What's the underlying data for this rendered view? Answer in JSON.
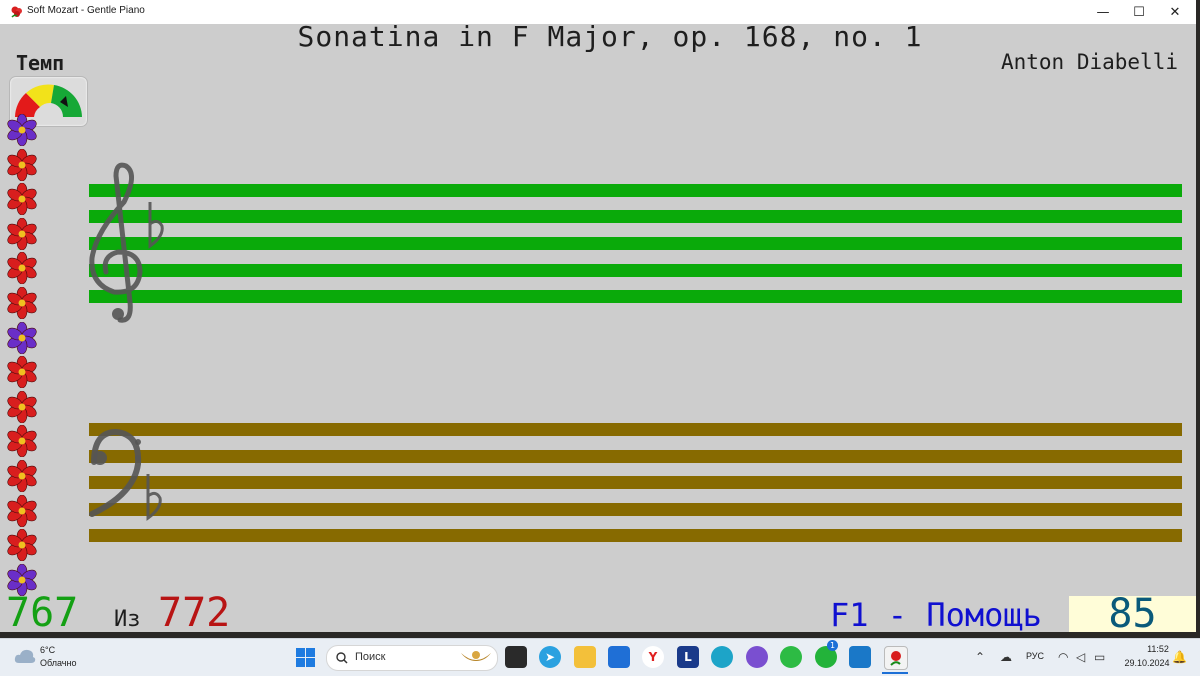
{
  "window": {
    "title": "Soft Mozart - Gentle Piano",
    "controls": {
      "minimize": "—",
      "maximize": "☐",
      "close": "✕"
    }
  },
  "score": {
    "title": "Sonatina in F Major, op. 168, no. 1",
    "composer": "Anton Diabelli",
    "tempo_label": "Темп",
    "treble_staff_color": "#0aaa0a",
    "bass_staff_color": "#876a00",
    "key_signature": "♭"
  },
  "progress": {
    "current": "767",
    "separator": "Из",
    "total": "772"
  },
  "help_label": "F1 - Помощь",
  "score_value": "85",
  "flowers": [
    "purple",
    "red",
    "red",
    "red",
    "red",
    "red",
    "purple",
    "red",
    "red",
    "red",
    "red",
    "red",
    "red",
    "purple"
  ],
  "colors": {
    "flower_red": "#d81e1e",
    "flower_purple": "#6a2ec8",
    "flower_center": "#f0c020"
  },
  "taskbar": {
    "weather_temp": "6°C",
    "weather_desc": "Облачно",
    "search_placeholder": "Поиск",
    "language": "РУС",
    "time": "11:52",
    "date": "29.10.2024",
    "whatsapp_badge": "1",
    "apps": [
      "start-icon",
      "search-icon",
      "badge-app-icon",
      "task-view-icon",
      "telegram-icon",
      "file-explorer-icon",
      "store-icon",
      "yandex-browser-icon",
      "l-app-icon",
      "edge-icon",
      "viber-icon",
      "wechat-icon",
      "whatsapp-icon",
      "webview-icon",
      "soft-mozart-icon"
    ]
  }
}
